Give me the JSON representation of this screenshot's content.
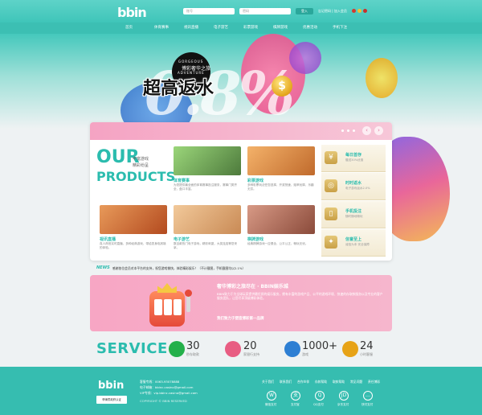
{
  "header": {
    "logo": "bbin",
    "search1_placeholder": "账号",
    "search2_placeholder": "密码",
    "search_button": "登入",
    "top_links": "忘记密码 | 加入会员"
  },
  "nav": [
    "首页",
    "体育赛事",
    "视讯直播",
    "电子游艺",
    "彩票游戏",
    "棋牌游戏",
    "优惠活动",
    "手机下注"
  ],
  "hero": {
    "badge_en1": "GORGEOUS",
    "badge_cn": "博彩奢华之旅",
    "badge_en2": "ADVENTURE",
    "title": "超高返水",
    "big_numerals": "0.8%",
    "coin_symbol": "$"
  },
  "products": {
    "heading1": "OUR",
    "heading2": "PRODUCTS",
    "side_cn1": "丰富游戏",
    "side_cn2": "精彩纷呈",
    "cards": [
      {
        "title": "体育赛事",
        "desc": "为您提供最全面的体育赛事投注服务，赛事门类齐全，盘口丰富。",
        "color": "#4d7a3c"
      },
      {
        "title": "彩票游戏",
        "desc": "多种彩票玩法任您选择，开奖快速，赔率优厚，乐趣无穷。",
        "color": "#c06a2c"
      },
      {
        "title": "视讯直播",
        "desc": "真人荷官实时直播，多种经典游戏，带给您身临其境的体验。",
        "color": "#b34a1f"
      },
      {
        "title": "电子游艺",
        "desc": "数百款热门电子游戏，精彩刺激，大奖连连等您来拿。",
        "color": "#c98a55"
      },
      {
        "title": "棋牌游戏",
        "desc": "经典棋牌游戏一应俱全，公平公正，畅玩无忧。",
        "color": "#8a4a3a"
      }
    ],
    "side": [
      {
        "title": "每日首存",
        "desc": "赠送30%优惠",
        "icon": "piggy-bank-icon",
        "glyph": "¥"
      },
      {
        "title": "时时返水",
        "desc": "电子游戏返水2.0%",
        "icon": "coins-icon",
        "glyph": "◎"
      },
      {
        "title": "手机投注",
        "desc": "随时随地畅玩",
        "icon": "mobile-icon",
        "glyph": "▯"
      },
      {
        "title": "信誉至上",
        "desc": "诚信为本 安全保障",
        "icon": "handshake-icon",
        "glyph": "✦"
      }
    ]
  },
  "news": {
    "label": "NEWS",
    "text": "感谢各位会员对本平台的支持，祝您游戏愉快，体验精彩娱乐！（不计截图，手机截图均以2.1%）"
  },
  "banner": {
    "title": "奢华博彩之旅尽在 · BBIN娱乐城",
    "body": "BBIN致力于为全球玩家提供最优质的娱乐服务，拥有丰富的游戏产品、公平的游戏环境、快速的存取款服务以及专业的客户服务团队，让您尽享顶级博彩体验。",
    "slogan": "我们致力于塑造博彩第一品牌"
  },
  "service": {
    "title": "SERVICE",
    "items": [
      {
        "num": "30",
        "label": "秒存取款",
        "color": "#23b04a"
      },
      {
        "num": "20",
        "label": "家银行支持",
        "color": "#e85d82"
      },
      {
        "num": "1000+",
        "label": "游戏",
        "color": "#2d7fd3"
      },
      {
        "num": "24",
        "label": "小时客服",
        "color": "#e7a317"
      }
    ]
  },
  "footer": {
    "logo": "bbin",
    "cert": "菲律宾政府认证",
    "line1": "客服专线：0063-93078888",
    "line2": "电子邮箱：bbinc.casino@gmail.com",
    "line3": "VIP专线：vip.bbinc.casino@gmail.com",
    "copyright": "COPYRIGHT © BBIN RESERVED",
    "links": [
      "关于我们",
      "联系我们",
      "合作伙伴",
      "存款帮助",
      "取款帮助",
      "常见问题",
      "责任博彩"
    ],
    "pay": [
      {
        "label": "微信支付",
        "glyph": "W",
        "icon": "wechat-pay-icon"
      },
      {
        "label": "支付宝",
        "glyph": "支",
        "icon": "alipay-icon"
      },
      {
        "label": "QQ支付",
        "glyph": "Q",
        "icon": "qq-pay-icon"
      },
      {
        "label": "京东支付",
        "glyph": "JD",
        "icon": "jd-pay-icon"
      },
      {
        "label": "快付支付",
        "glyph": "…",
        "icon": "fast-pay-icon"
      }
    ]
  }
}
